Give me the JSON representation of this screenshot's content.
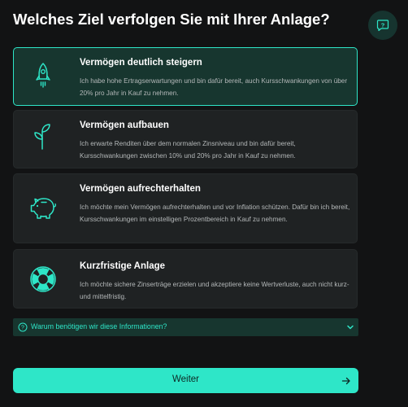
{
  "page": {
    "title": "Welches Ziel verfolgen Sie mit Ihrer Anlage?"
  },
  "help_button": {
    "icon": "help-question-icon",
    "symbol": "?"
  },
  "options": [
    {
      "icon": "rocket-icon",
      "title": "Vermögen deutlich steigern",
      "description": "Ich habe hohe Ertragserwartungen und bin dafür bereit, auch Kursschwankungen von über 20% pro Jahr in Kauf zu nehmen.",
      "selected": true
    },
    {
      "icon": "sprout-icon",
      "title": "Vermögen aufbauen",
      "description": "Ich erwarte Renditen über dem normalen Zinsniveau und bin dafür bereit, Kursschwankungen zwischen 10% und 20% pro Jahr in Kauf zu nehmen.",
      "selected": false
    },
    {
      "icon": "piggy-bank-icon",
      "title": "Vermögen aufrechterhalten",
      "description": "Ich möchte mein Vermögen aufrechterhalten und vor Inflation schützen. Dafür bin ich bereit, Kursschwankungen im einstelligen Prozentbereich in Kauf zu nehmen.",
      "selected": false
    },
    {
      "icon": "lifebuoy-icon",
      "title": "Kurzfristige Anlage",
      "description": "Ich möchte sichere Zinserträge erzielen und akzeptiere keine Wertverluste, auch nicht kurz- und mittelfristig.",
      "selected": false
    }
  ],
  "info": {
    "icon": "question-circle-icon",
    "text": "Warum benötigen wir diese Informationen?",
    "expand_icon": "chevron-down-icon"
  },
  "primary_button": {
    "label": "Weiter",
    "icon": "arrow-right-icon"
  },
  "colors": {
    "background": "#121314",
    "card": "#1f2223",
    "selected_card": "#17362f",
    "accent": "#2ee6c8",
    "text": "#ffffff",
    "muted_text": "#b4b8b9"
  }
}
